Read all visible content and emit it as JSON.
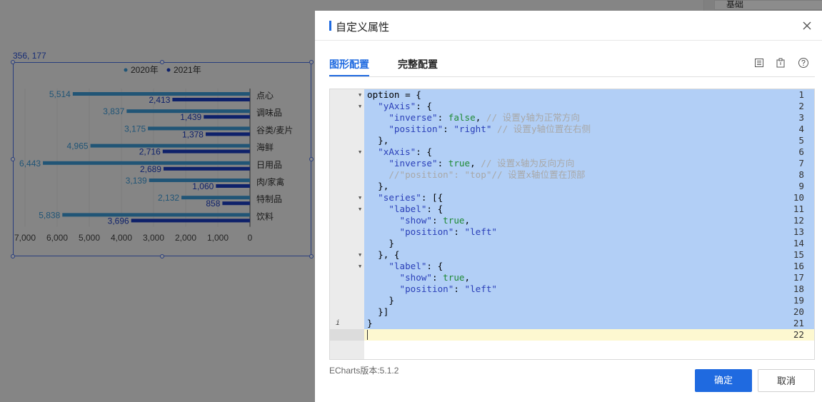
{
  "workspace": {
    "coord_label": "356, 177",
    "right_section": "基础"
  },
  "chart_data": {
    "type": "bar",
    "orientation": "horizontal",
    "categories": [
      "点心",
      "调味品",
      "谷类/麦片",
      "海鲜",
      "日用品",
      "肉/家禽",
      "特制品",
      "饮料"
    ],
    "series": [
      {
        "name": "2020年",
        "values": [
          5514,
          3837,
          3175,
          4965,
          6443,
          3139,
          2132,
          5838
        ]
      },
      {
        "name": "2021年",
        "values": [
          2413,
          1439,
          1378,
          2716,
          2689,
          1060,
          858,
          3696
        ]
      }
    ],
    "x_ticks": [
      "7,000",
      "6,000",
      "5,000",
      "4,000",
      "3,000",
      "2,000",
      "1,000",
      "0"
    ],
    "xlim": [
      0,
      7000
    ],
    "x_inverse": true,
    "y_axis_position": "right",
    "legend_position": "top-center",
    "colors": [
      "#3d9bd8",
      "#1a3dc2"
    ]
  },
  "modal": {
    "title": "自定义属性",
    "tabs": [
      "图形配置",
      "完整配置"
    ],
    "active_tab": "图形配置",
    "icons": [
      "document-icon",
      "clipboard-icon",
      "help-icon"
    ],
    "version": "ECharts版本:5.1.2",
    "ok_label": "确定",
    "cancel_label": "取消",
    "accent": "#1f6ae0"
  },
  "editor": {
    "current_line": 22,
    "lines": [
      "option = {",
      "  \"yAxis\": {",
      "    \"inverse\": false, // 设置y轴为正常方向",
      "    \"position\": \"right\" // 设置y轴位置在右侧",
      "  },",
      "  \"xAxis\": {",
      "    \"inverse\": true, // 设置x轴为反向方向",
      "    //\"position\": \"top\"// 设置x轴位置在顶部",
      "  },",
      "  \"series\": [{",
      "    \"label\": {",
      "      \"show\": true,",
      "      \"position\": \"left\"",
      "    }",
      "  }, {",
      "    \"label\": {",
      "      \"show\": true,",
      "      \"position\": \"left\"",
      "    }",
      "  }]",
      "}",
      ""
    ]
  }
}
